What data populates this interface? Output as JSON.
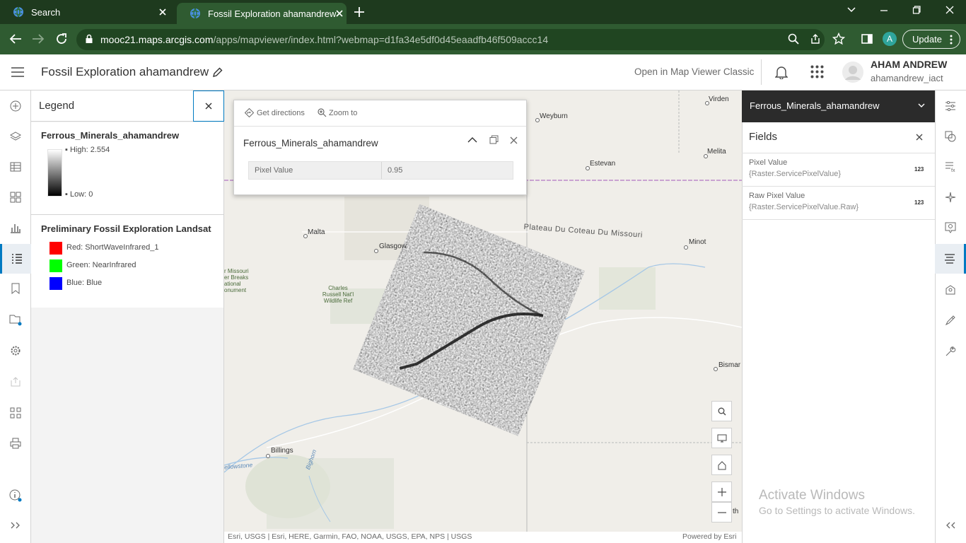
{
  "browser": {
    "tabs": [
      {
        "label": "Search"
      },
      {
        "label": "Fossil Exploration ahamandrew"
      }
    ],
    "url_host": "mooc21.maps.arcgis.com",
    "url_rest": "/apps/mapviewer/index.html?webmap=d1fa34e5df0d45eaadfb46f509accc14",
    "profile_initial": "A",
    "update_label": "Update"
  },
  "header": {
    "map_title": "Fossil Exploration ahamandrew",
    "open_classic": "Open in Map Viewer Classic",
    "user_name": "AHAM ANDREW",
    "user_id": "ahamandrew_iact"
  },
  "left_toolbar": {
    "items": [
      "add-icon",
      "layers-icon",
      "table-icon",
      "basemap-icon",
      "charts-icon",
      "legend-icon",
      "bookmark-icon",
      "folder-icon",
      "settings-icon",
      "share-icon",
      "apps-icon",
      "print-icon",
      "info-icon",
      "expand-icon"
    ],
    "active": "legend-icon"
  },
  "legend": {
    "title": "Legend",
    "layer1": {
      "name": "Ferrous_Minerals_ahamandrew",
      "high": "High: 2.554",
      "low": "Low: 0"
    },
    "layer2": {
      "name": "Preliminary Fossil Exploration Landsat",
      "bands": [
        {
          "label": "Red: ShortWaveInfrared_1",
          "color": "#ff0000"
        },
        {
          "label": "Green: NearInfrared",
          "color": "#00ff00"
        },
        {
          "label": "Blue: Blue",
          "color": "#0000ff"
        }
      ]
    }
  },
  "popup": {
    "get_directions": "Get directions",
    "zoom_to": "Zoom to",
    "title": "Ferrous_Minerals_ahamandrew",
    "field_label": "Pixel Value",
    "field_value": "0.95"
  },
  "map": {
    "cities": {
      "virden": "Virden",
      "weyburn": "Weyburn",
      "estevan": "Estevan",
      "melita": "Melita",
      "malta": "Malta",
      "glasgow": "Glasgow",
      "minot": "Minot",
      "billings": "Billings",
      "bismarck": "Bismar"
    },
    "plateau": "Plateau Du Coteau Du Missouri",
    "cmr_lines": [
      "Charles",
      "Russell Nat'l",
      "Wildlife Ref"
    ],
    "missouri_lines": [
      "r Missouri",
      "er Breaks",
      "ational",
      "onument"
    ],
    "yellowstone": "ellowstone",
    "bighorn": "Bighorn",
    "edge_th": "th",
    "attribution": "Esri, USGS | Esri, HERE, Garmin, FAO, NOAA, USGS, EPA, NPS | USGS",
    "powered_by": "Powered by Esri"
  },
  "fields_panel": {
    "layer_dropdown": "Ferrous_Minerals_ahamandrew",
    "title": "Fields",
    "fields": [
      {
        "name": "Pixel Value",
        "expr": "{Raster.ServicePixelValue}",
        "type": "123"
      },
      {
        "name": "Raw Pixel Value",
        "expr": "{Raster.ServicePixelValue.Raw}",
        "type": "123"
      }
    ]
  },
  "right_toolbar": {
    "items": [
      "properties-icon",
      "styles-icon",
      "fields-expression-icon",
      "effects-icon",
      "popups-icon",
      "fields-icon",
      "labels-icon",
      "sketch-icon",
      "configure-icon",
      "collapse-icon"
    ],
    "active": "fields-icon"
  },
  "watermark": {
    "line1": "Activate Windows",
    "line2": "Go to Settings to activate Windows."
  }
}
